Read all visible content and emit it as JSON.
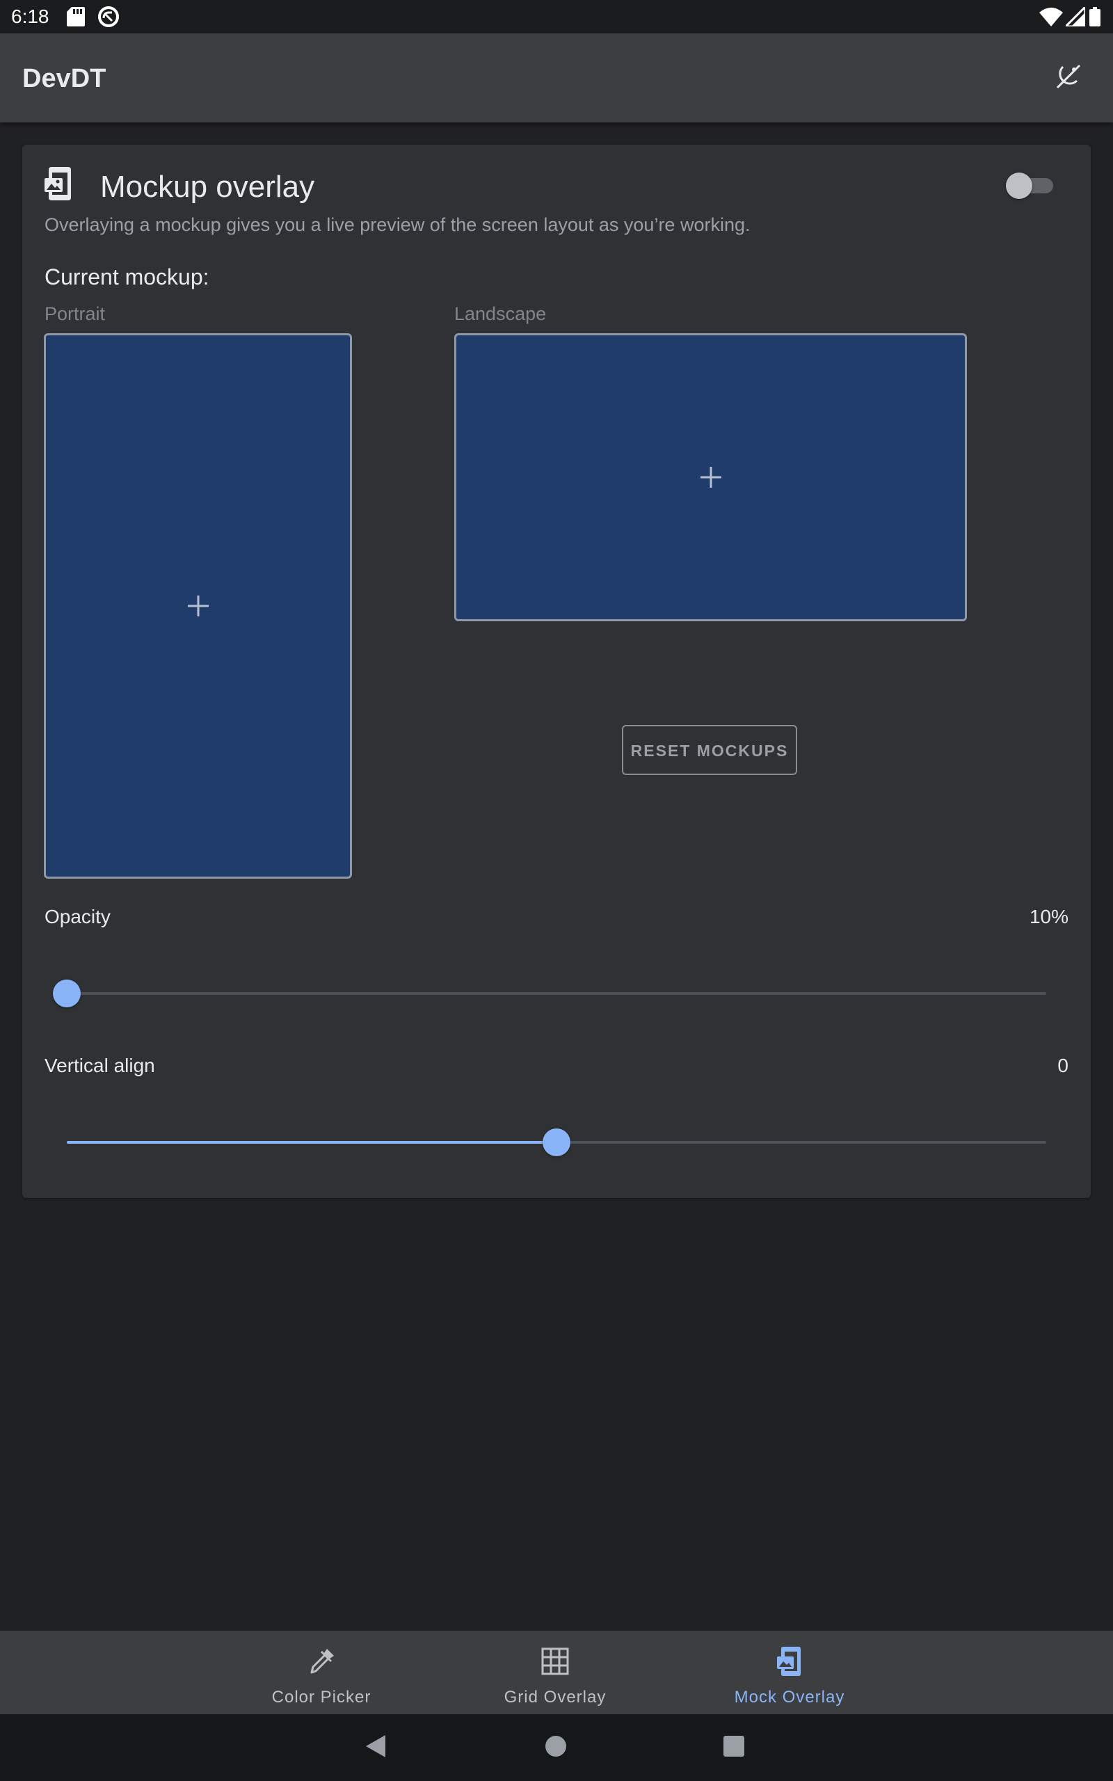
{
  "status_bar": {
    "time": "6:18"
  },
  "app_bar": {
    "title": "DevDT"
  },
  "card": {
    "title": "Mockup overlay",
    "enabled": false,
    "description": "Overlaying a mockup gives you a live preview of the screen layout as you’re working.",
    "current_mockup_label": "Current mockup:",
    "portrait_label": "Portrait",
    "landscape_label": "Landscape",
    "reset_button": "RESET MOCKUPS",
    "opacity": {
      "label": "Opacity",
      "value_text": "10%",
      "value": 0
    },
    "vertical_align": {
      "label": "Vertical align",
      "value_text": "0",
      "value": 0.5
    }
  },
  "bottom_nav": {
    "items": [
      {
        "label": "Color Picker",
        "icon": "eyedropper-icon",
        "active": false
      },
      {
        "label": "Grid Overlay",
        "icon": "grid-icon",
        "active": false
      },
      {
        "label": "Mock Overlay",
        "icon": "mock-overlay-icon",
        "active": true
      }
    ]
  },
  "colors": {
    "accent": "#8ab4f8",
    "background": "#202124",
    "card": "#303134",
    "mockup_fill": "#1f3c6b",
    "app_bar": "#3d3e40"
  }
}
